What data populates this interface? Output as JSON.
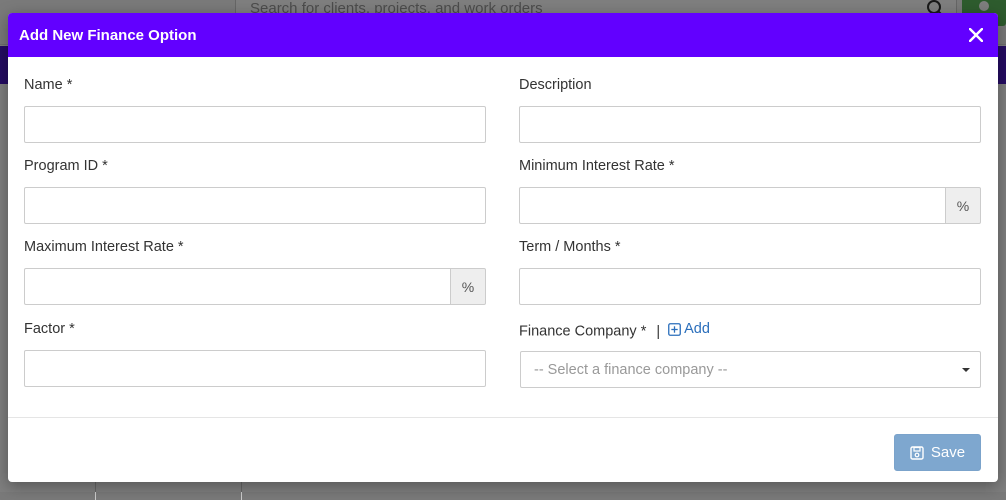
{
  "background": {
    "search_placeholder": "Search for clients, projects, and work orders"
  },
  "modal": {
    "title": "Add New Finance Option",
    "fields": {
      "name": {
        "label": "Name *",
        "value": ""
      },
      "description": {
        "label": "Description",
        "value": ""
      },
      "program_id": {
        "label": "Program ID *",
        "value": ""
      },
      "min_rate": {
        "label": "Minimum Interest Rate *",
        "value": "",
        "addon": "%"
      },
      "max_rate": {
        "label": "Maximum Interest Rate *",
        "value": "",
        "addon": "%"
      },
      "term": {
        "label": "Term / Months *",
        "value": ""
      },
      "factor": {
        "label": "Factor *",
        "value": ""
      },
      "finance_company": {
        "label": "Finance Company *",
        "separator": "|",
        "add_label": "Add",
        "placeholder": "-- Select a finance company --"
      }
    },
    "save_label": "Save"
  },
  "colors": {
    "header": "#6200ff",
    "save_button": "#7ea7cf",
    "link": "#2a6ebb"
  }
}
